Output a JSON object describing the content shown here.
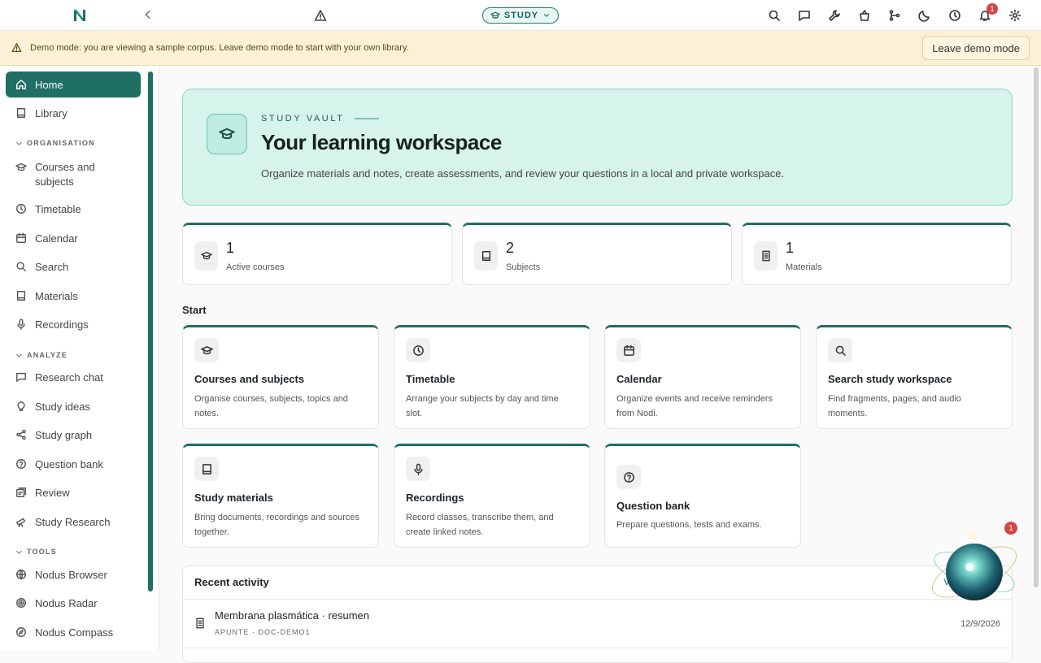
{
  "topbar": {
    "mode_label": "STUDY",
    "notification_count": "1"
  },
  "demo": {
    "text": "Demo mode: you are viewing a sample corpus. Leave demo mode to start with your own library.",
    "button": "Leave demo mode"
  },
  "sidebar": {
    "home": "Home",
    "library": "Library",
    "sections": {
      "organisation": "ORGANISATION",
      "analyze": "ANALYZE",
      "tools": "TOOLS"
    },
    "items": {
      "courses": "Courses and subjects",
      "timetable": "Timetable",
      "calendar": "Calendar",
      "search": "Search",
      "materials": "Materials",
      "recordings": "Recordings",
      "research_chat": "Research chat",
      "study_ideas": "Study ideas",
      "study_graph": "Study graph",
      "question_bank": "Question bank",
      "review": "Review",
      "study_research": "Study Research",
      "nodus_browser": "Nodus Browser",
      "nodus_radar": "Nodus Radar",
      "nodus_compass": "Nodus Compass"
    }
  },
  "hero": {
    "kicker": "STUDY VAULT",
    "title": "Your learning workspace",
    "description": "Organize materials and notes, create assessments, and review your questions in a local and private workspace."
  },
  "stats": [
    {
      "value": "1",
      "label": "Active courses",
      "icon": "graduation-cap-icon"
    },
    {
      "value": "2",
      "label": "Subjects",
      "icon": "book-icon"
    },
    {
      "value": "1",
      "label": "Materials",
      "icon": "document-icon"
    }
  ],
  "start": {
    "heading": "Start",
    "cards": [
      {
        "title": "Courses and subjects",
        "desc": "Organise courses, subjects, topics and notes.",
        "icon": "graduation-cap-icon"
      },
      {
        "title": "Timetable",
        "desc": "Arrange your subjects by day and time slot.",
        "icon": "clock-icon"
      },
      {
        "title": "Calendar",
        "desc": "Organize events and receive reminders from Nodi.",
        "icon": "calendar-icon"
      },
      {
        "title": "Search study workspace",
        "desc": "Find fragments, pages, and audio moments.",
        "icon": "search-icon"
      },
      {
        "title": "Study materials",
        "desc": "Bring documents, recordings and sources together.",
        "icon": "book-icon"
      },
      {
        "title": "Recordings",
        "desc": "Record classes, transcribe them, and create linked notes.",
        "icon": "microphone-icon"
      },
      {
        "title": "Question bank",
        "desc": "Prepare questions, tests and exams.",
        "icon": "question-circle-icon"
      }
    ]
  },
  "recent": {
    "heading": "Recent activity",
    "view_all": "Vi",
    "items": [
      {
        "title": "Membrana plasmática · resumen",
        "meta": "APUNTE · DOC-DEMO1",
        "date": "12/9/2026",
        "icon": "document-icon"
      }
    ]
  },
  "assistant": {
    "badge": "1"
  },
  "colors": {
    "accent": "#1f6f64",
    "hero_bg": "#d6f4ec",
    "demo_bg": "#fcf1d6",
    "badge": "#d64545"
  }
}
